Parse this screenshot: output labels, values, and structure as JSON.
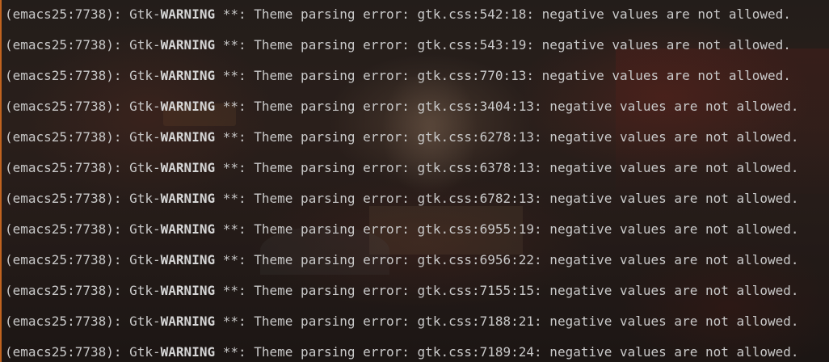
{
  "terminal": {
    "lines": [
      {
        "prefix": "(emacs25:7738): Gtk-",
        "level": "WARNING",
        "message": " **: Theme parsing error: gtk.css:542:18: negative values are not allowed."
      },
      {
        "prefix": "(emacs25:7738): Gtk-",
        "level": "WARNING",
        "message": " **: Theme parsing error: gtk.css:543:19: negative values are not allowed."
      },
      {
        "prefix": "(emacs25:7738): Gtk-",
        "level": "WARNING",
        "message": " **: Theme parsing error: gtk.css:770:13: negative values are not allowed."
      },
      {
        "prefix": "(emacs25:7738): Gtk-",
        "level": "WARNING",
        "message": " **: Theme parsing error: gtk.css:3404:13: negative values are not allowed."
      },
      {
        "prefix": "(emacs25:7738): Gtk-",
        "level": "WARNING",
        "message": " **: Theme parsing error: gtk.css:6278:13: negative values are not allowed."
      },
      {
        "prefix": "(emacs25:7738): Gtk-",
        "level": "WARNING",
        "message": " **: Theme parsing error: gtk.css:6378:13: negative values are not allowed."
      },
      {
        "prefix": "(emacs25:7738): Gtk-",
        "level": "WARNING",
        "message": " **: Theme parsing error: gtk.css:6782:13: negative values are not allowed."
      },
      {
        "prefix": "(emacs25:7738): Gtk-",
        "level": "WARNING",
        "message": " **: Theme parsing error: gtk.css:6955:19: negative values are not allowed."
      },
      {
        "prefix": "(emacs25:7738): Gtk-",
        "level": "WARNING",
        "message": " **: Theme parsing error: gtk.css:6956:22: negative values are not allowed."
      },
      {
        "prefix": "(emacs25:7738): Gtk-",
        "level": "WARNING",
        "message": " **: Theme parsing error: gtk.css:7155:15: negative values are not allowed."
      },
      {
        "prefix": "(emacs25:7738): Gtk-",
        "level": "WARNING",
        "message": " **: Theme parsing error: gtk.css:7188:21: negative values are not allowed."
      },
      {
        "prefix": "(emacs25:7738): Gtk-",
        "level": "WARNING",
        "message": " **: Theme parsing error: gtk.css:7189:24: negative values are not allowed."
      }
    ]
  },
  "colors": {
    "text": "#c9c9c9",
    "accent_border": "#c0631f",
    "background": "#231d1a"
  }
}
